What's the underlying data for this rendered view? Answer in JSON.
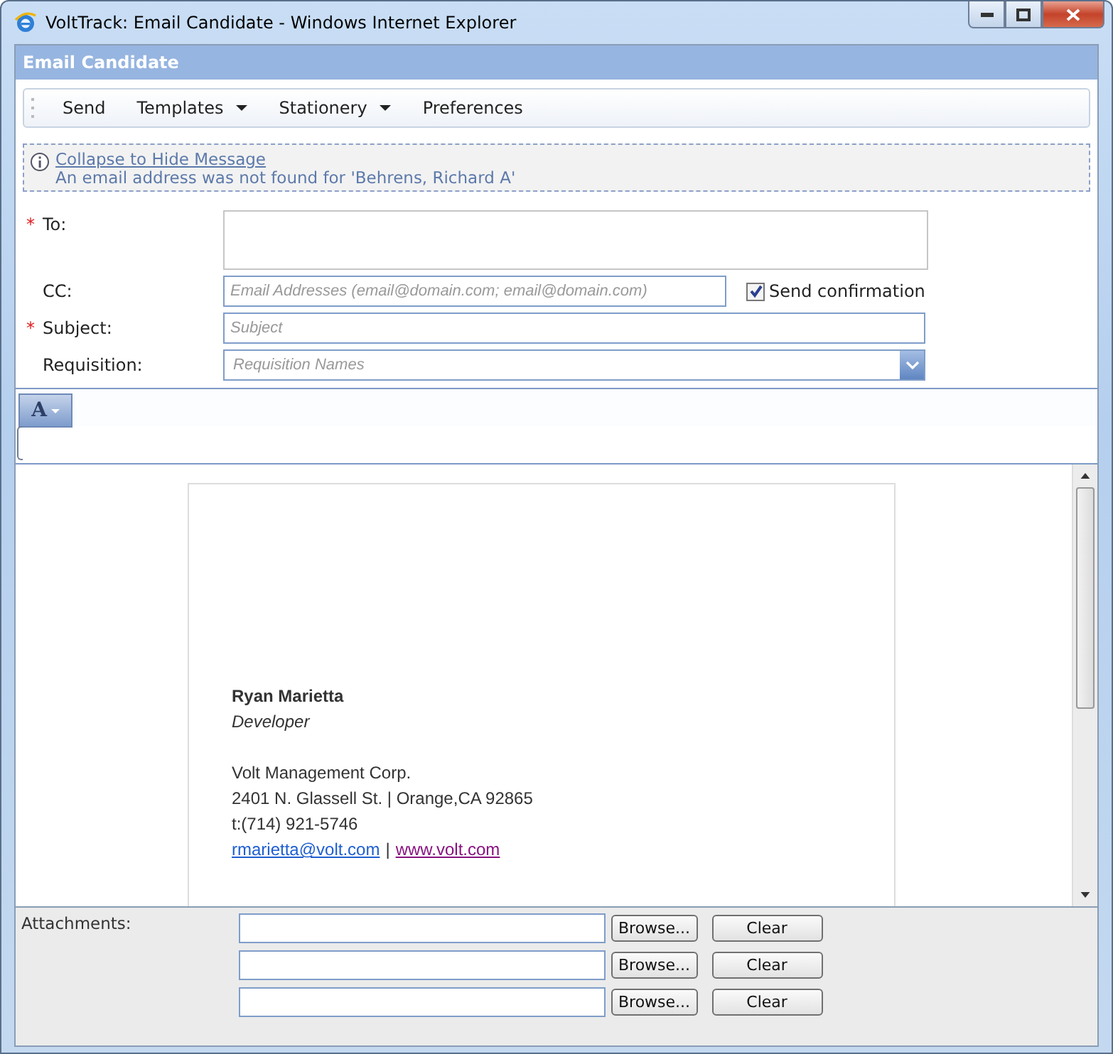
{
  "window": {
    "title": "VoltTrack: Email Candidate - Windows Internet Explorer"
  },
  "panel": {
    "title": "Email Candidate"
  },
  "toolbar": [
    {
      "label": "Send",
      "dropdown": false
    },
    {
      "label": "Templates",
      "dropdown": true
    },
    {
      "label": "Stationery",
      "dropdown": true
    },
    {
      "label": "Preferences",
      "dropdown": false
    }
  ],
  "notice": {
    "link": "Collapse to Hide Message",
    "message": "An email address was not found for 'Behrens, Richard A'"
  },
  "fields": [
    {
      "kind": "textarea",
      "label": "To:",
      "required_mark": "*"
    },
    {
      "kind": "text",
      "label": "CC:",
      "placeholder": "Email Addresses (email@domain.com; email@domain.com)",
      "option": {
        "label": "Send confirmation",
        "checked": true
      }
    },
    {
      "kind": "text",
      "label": "Subject:",
      "required_mark": "*",
      "placeholder": "Subject"
    },
    {
      "kind": "select",
      "label": "Requisition:",
      "placeholder": "Requisition Names"
    }
  ],
  "editor": {
    "format_button": "A",
    "signature": [
      {
        "kind": "name",
        "text": "Ryan Marietta"
      },
      {
        "kind": "title",
        "text": "Developer"
      },
      {
        "kind": "gap"
      },
      {
        "kind": "text",
        "text": "Volt Management Corp."
      },
      {
        "kind": "text",
        "text": "2401 N. Glassell St. | Orange,CA 92865"
      },
      {
        "kind": "text",
        "text": "t:(714) 921-5746"
      },
      {
        "kind": "links",
        "email": "rmarietta@volt.com",
        "separator": "|",
        "website": "www.volt.com"
      }
    ]
  },
  "attachments": {
    "label": "Attachments:",
    "rows": [
      {
        "browse": "Browse...",
        "clear": "Clear"
      },
      {
        "browse": "Browse...",
        "clear": "Clear"
      },
      {
        "browse": "Browse...",
        "clear": "Clear"
      }
    ]
  }
}
